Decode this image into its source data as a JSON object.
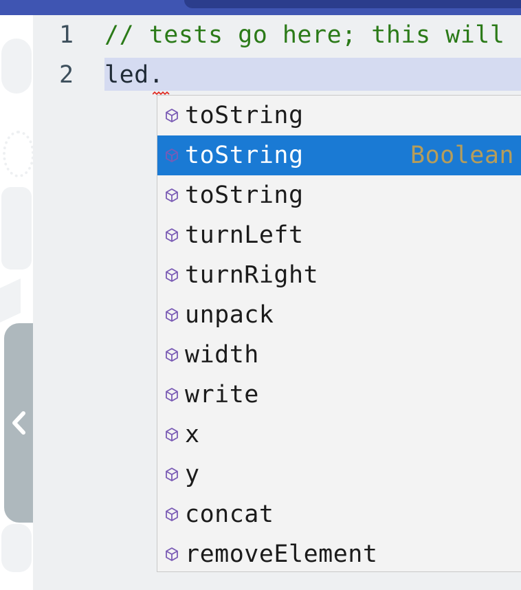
{
  "editor": {
    "lines": [
      {
        "number": "1",
        "text": "// tests go here; this will"
      },
      {
        "number": "2",
        "text": "led."
      }
    ]
  },
  "suggest": {
    "selected_index": 1,
    "items": [
      {
        "label": "toString",
        "detail": ""
      },
      {
        "label": "toString",
        "detail": "Boolean"
      },
      {
        "label": "toString",
        "detail": ""
      },
      {
        "label": "turnLeft",
        "detail": ""
      },
      {
        "label": "turnRight",
        "detail": ""
      },
      {
        "label": "unpack",
        "detail": ""
      },
      {
        "label": "width",
        "detail": ""
      },
      {
        "label": "write",
        "detail": ""
      },
      {
        "label": "x",
        "detail": ""
      },
      {
        "label": "y",
        "detail": ""
      },
      {
        "label": "concat",
        "detail": ""
      },
      {
        "label": "removeElement",
        "detail": ""
      }
    ],
    "icon": "property-cube-icon"
  },
  "colors": {
    "selection": "#1a7ad4",
    "comment": "#2b7a18",
    "icon": "#7a5bb5",
    "type_detail": "#b69d5a",
    "current_line": "#d5dbf1"
  }
}
